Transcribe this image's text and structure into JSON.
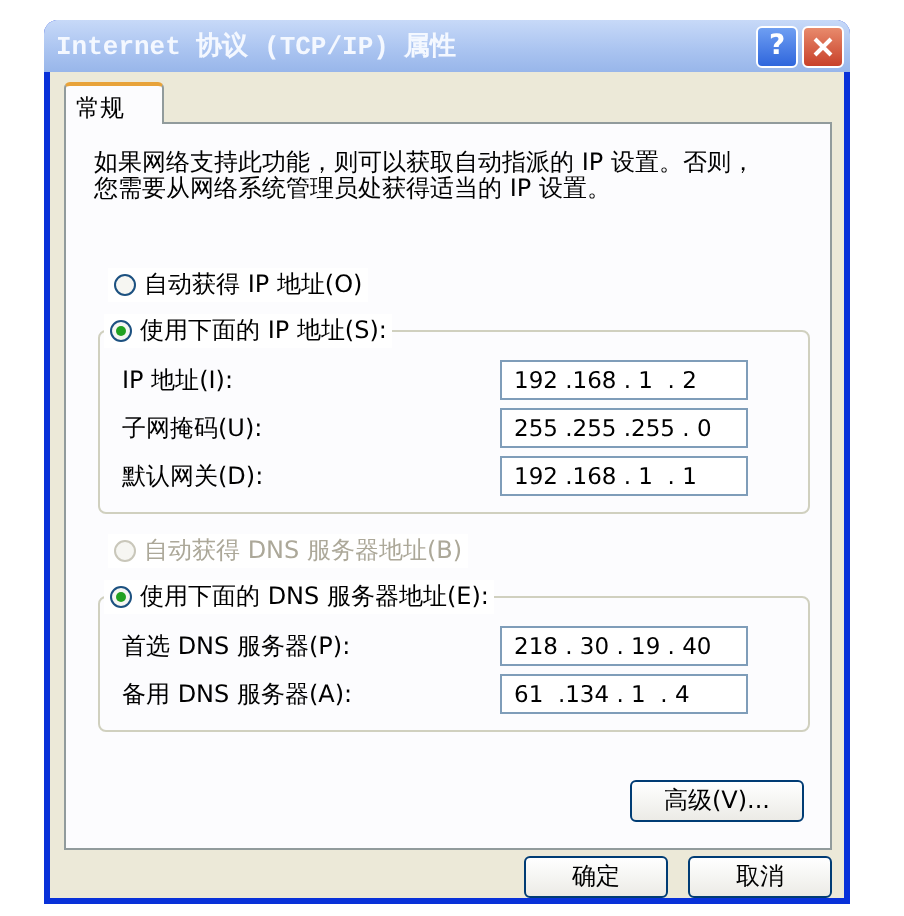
{
  "window": {
    "title": "Internet 协议 (TCP/IP) 属性",
    "help": "?"
  },
  "tabs": [
    {
      "label": "常规",
      "selected": true
    }
  ],
  "description_lines": [
    "如果网络支持此功能，则可以获取自动指派的 IP 设置。否则，",
    "您需要从网络系统管理员处获得适当的 IP 设置。"
  ],
  "sections": [
    {
      "options": [
        {
          "label": "自动获得 IP 地址(O)",
          "selected": false,
          "disabled": false
        },
        {
          "label": "使用下面的 IP 地址(S):",
          "selected": true,
          "disabled": false
        }
      ],
      "fields": [
        {
          "label": "IP 地址(I):",
          "value": "192 .168 . 1  . 2"
        },
        {
          "label": "子网掩码(U):",
          "value": "255 .255 .255 . 0"
        },
        {
          "label": "默认网关(D):",
          "value": "192 .168 . 1  . 1"
        }
      ]
    },
    {
      "options": [
        {
          "label": "自动获得 DNS 服务器地址(B)",
          "selected": false,
          "disabled": true
        },
        {
          "label": "使用下面的 DNS 服务器地址(E):",
          "selected": true,
          "disabled": false
        }
      ],
      "fields": [
        {
          "label": "首选 DNS 服务器(P):",
          "value": "218 . 30 . 19 . 40"
        },
        {
          "label": "备用 DNS 服务器(A):",
          "value": "61  .134 . 1  . 4"
        }
      ]
    }
  ],
  "advanced_button": "高级(V)...",
  "buttons": [
    "确定",
    "取消"
  ]
}
